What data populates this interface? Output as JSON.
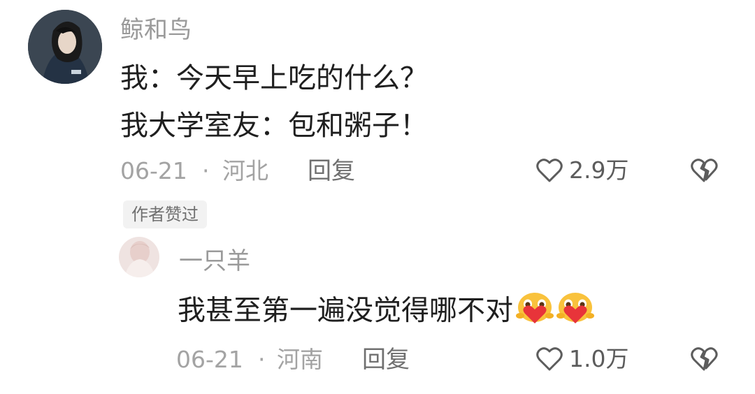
{
  "comment": {
    "username": "鲸和鸟",
    "lines": [
      "我：今天早上吃的什么？",
      "我大学室友：包和粥子！"
    ],
    "date": "06-21",
    "separator": "·",
    "location": "河北",
    "reply_label": "回复",
    "like_count": "2.9万",
    "author_badge": "作者赞过"
  },
  "reply": {
    "username": "一只羊",
    "text": "我甚至第一遍没觉得哪不对",
    "emojis": [
      "heart-hug-emoji",
      "heart-hug-emoji"
    ],
    "date": "06-21",
    "separator": "·",
    "location": "河南",
    "reply_label": "回复",
    "like_count": "1.0万"
  },
  "icons": {
    "like": "heart-outline-icon",
    "dislike": "broken-heart-icon"
  },
  "colors": {
    "meta_gray": "#a3a3a3",
    "text": "#1f1f1f",
    "emoji_yellow": "#f9c23c",
    "emoji_heart": "#e8343a"
  }
}
